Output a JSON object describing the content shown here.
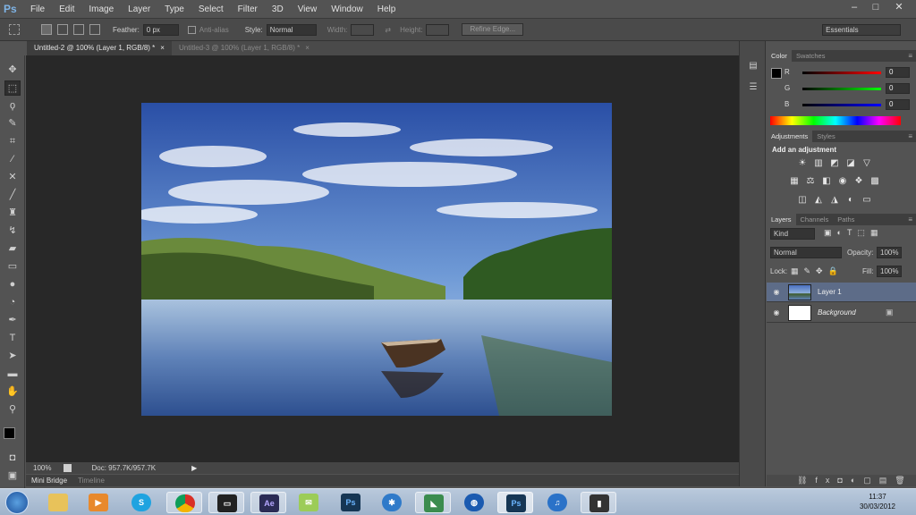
{
  "app": {
    "logo": "Ps"
  },
  "menu": [
    "File",
    "Edit",
    "Image",
    "Layer",
    "Type",
    "Select",
    "Filter",
    "3D",
    "View",
    "Window",
    "Help"
  ],
  "window_controls": {
    "minimize": "–",
    "maximize": "□",
    "close": "✕"
  },
  "options": {
    "feather_label": "Feather:",
    "feather_value": "0 px",
    "antialias_label": "Anti-alias",
    "style_label": "Style:",
    "style_value": "Normal",
    "width_label": "Width:",
    "height_label": "Height:",
    "refine_label": "Refine Edge...",
    "workspace": "Essentials"
  },
  "tabs": [
    {
      "label": "Untitled-2 @ 100% (Layer 1, RGB/8) *",
      "active": true
    },
    {
      "label": "Untitled-3 @ 100% (Layer 1, RGB/8) *",
      "active": false
    }
  ],
  "status": {
    "zoom": "100%",
    "doc": "Doc: 957.7K/957.7K"
  },
  "bottom_tabs": [
    "Mini Bridge",
    "Timeline"
  ],
  "color_panel": {
    "tabs": [
      "Color",
      "Swatches"
    ],
    "r_label": "R",
    "r_value": "0",
    "g_label": "G",
    "g_value": "0",
    "b_label": "B",
    "b_value": "0"
  },
  "adjustments_panel": {
    "tabs": [
      "Adjustments",
      "Styles"
    ],
    "heading": "Add an adjustment"
  },
  "layers_panel": {
    "tabs": [
      "Layers",
      "Channels",
      "Paths"
    ],
    "kind": "Kind",
    "blend_mode": "Normal",
    "opacity_label": "Opacity:",
    "opacity_value": "100%",
    "lock_label": "Lock:",
    "fill_label": "Fill:",
    "fill_value": "100%",
    "layers": [
      {
        "name": "Layer 1",
        "selected": true
      },
      {
        "name": "Background",
        "selected": false
      }
    ]
  },
  "taskbar": {
    "apps": [
      "start",
      "explorer",
      "media-player",
      "skype",
      "chrome",
      "terminal",
      "after-effects",
      "notes",
      "photoshop",
      "network",
      "app-green",
      "globe",
      "photoshop-active",
      "itunes",
      "app-bin"
    ],
    "time": "11:37",
    "date": "30/03/2012"
  },
  "colors": {
    "accent_selected_layer": "#5d6c88",
    "panel_bg": "#535353",
    "canvas_bg": "#282828"
  }
}
